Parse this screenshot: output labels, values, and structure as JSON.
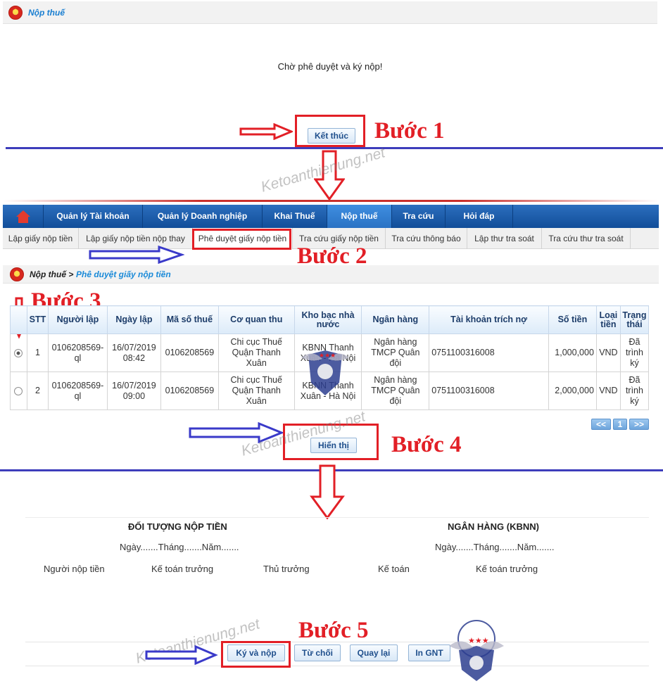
{
  "section1": {
    "header_title": "Nộp thuế",
    "message": "Chờ phê duyệt và ký nộp!",
    "finish_button": "Kết thúc"
  },
  "steps": {
    "step1": "Bước 1",
    "step2": "Bước 2",
    "step3": "Bước 3",
    "step4": "Bước 4",
    "step5": "Bước 5"
  },
  "watermark": "Ketoanthienung.net",
  "nav": {
    "items": [
      "Quản lý Tài khoản",
      "Quản lý Doanh nghiệp",
      "Khai Thuế",
      "Nộp thuế",
      "Tra cứu",
      "Hỏi đáp"
    ],
    "active": "Nộp thuế"
  },
  "subnav": {
    "items": [
      "Lập giấy nộp tiền",
      "Lập giấy nộp tiền nộp thay",
      "Phê duyệt giấy nộp tiền",
      "Tra cứu giấy nộp tiền",
      "Tra cứu thông báo",
      "Lập thư tra soát",
      "Tra cứu thư tra soát"
    ]
  },
  "breadcrumb": {
    "root": "Nộp thuế >",
    "current": "Phê duyệt giấy nộp tiền"
  },
  "table": {
    "headers": [
      "",
      "STT",
      "Người lập",
      "Ngày lập",
      "Mã số thuế",
      "Cơ quan thu",
      "Kho bạc nhà nước",
      "Ngân hàng",
      "Tài khoản trích nợ",
      "Số tiền",
      "Loại tiền",
      "Trạng thái"
    ],
    "rows": [
      {
        "selected": true,
        "stt": "1",
        "nguoi_lap": "0106208569-ql",
        "ngay_lap": "16/07/2019 08:42",
        "mst": "0106208569",
        "co_quan_thu": "Chi cục Thuế Quận Thanh Xuân",
        "kho_bac": "KBNN Thanh Xuân - Hà Nội",
        "ngan_hang": "Ngân hàng TMCP Quân đội",
        "tai_khoan": "0751100316008",
        "so_tien": "1,000,000",
        "loai_tien": "VND",
        "trang_thai": "Đã trình ký"
      },
      {
        "selected": false,
        "stt": "2",
        "nguoi_lap": "0106208569-ql",
        "ngay_lap": "16/07/2019 09:00",
        "mst": "0106208569",
        "co_quan_thu": "Chi cục Thuế Quận Thanh Xuân",
        "kho_bac": "KBNN Thanh Xuân - Hà Nội",
        "ngan_hang": "Ngân hàng TMCP Quân đội",
        "tai_khoan": "0751100316008",
        "so_tien": "2,000,000",
        "loai_tien": "VND",
        "trang_thai": "Đã trình ký"
      }
    ]
  },
  "pagination": {
    "prev": "<<",
    "page": "1",
    "next": ">>"
  },
  "show_button": "Hiển thị",
  "signatures": {
    "left_title": "ĐỐI TƯỢNG NỘP TIỀN",
    "right_title": "NGÂN HÀNG (KBNN)",
    "date_line": "Ngày.......Tháng.......Năm.......",
    "roles": [
      "Người nộp tiền",
      "Kế toán trưởng",
      "Thủ trưởng",
      "Kế toán",
      "Kế toán trưởng"
    ]
  },
  "actions": {
    "sign": "Ký và nộp",
    "reject": "Từ chối",
    "back": "Quay lại",
    "print": "In GNT"
  },
  "colors": {
    "step_red": "#e21f26",
    "arrow_red": "#e21f26",
    "arrow_blue": "#3a3ac9",
    "nav_blue": "#1a5aa8",
    "divider_blue": "#3d3dbb"
  }
}
